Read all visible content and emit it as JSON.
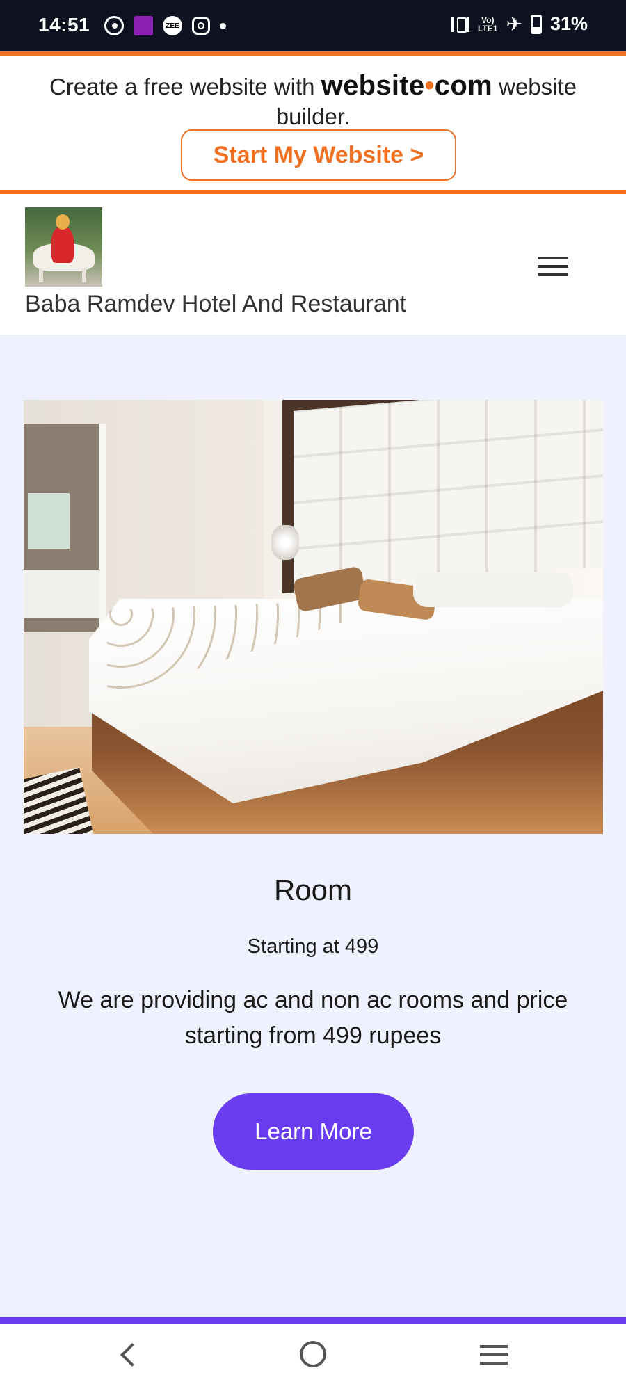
{
  "status_bar": {
    "time": "14:51",
    "battery": "31%",
    "network": "Vo)) LTE1",
    "icons_left": [
      "whatsapp-icon",
      "app-icon",
      "zee-icon",
      "instagram-icon",
      "dot-icon"
    ],
    "icons_right": [
      "vibrate-icon",
      "lte-icon",
      "airplane-icon",
      "battery-icon"
    ]
  },
  "promo": {
    "text_before": "Create a free website with",
    "brand_part1": "website",
    "brand_dot": "•",
    "brand_part2": "com",
    "text_after": "website builder.",
    "button_label": "Start My Website >",
    "accent_color": "#ee7023"
  },
  "header": {
    "site_name": "Baba Ramdev Hotel And Restaurant",
    "menu_icon": "hamburger-icon"
  },
  "room": {
    "title": "Room",
    "price": "Starting at 499",
    "description": "We are providing ac and non ac rooms and price starting from 499 rupees",
    "button_label": "Learn More",
    "button_color": "#6a3cf0"
  },
  "nav_bar": {
    "icons": [
      "back-icon",
      "home-icon",
      "recents-icon"
    ]
  }
}
